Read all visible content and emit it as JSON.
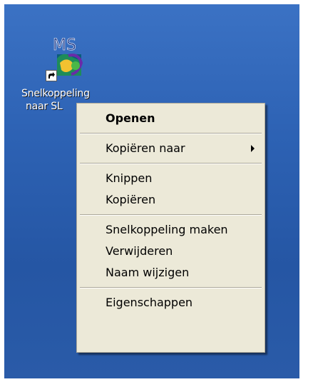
{
  "desktop": {
    "shortcut": {
      "icon": "ms-vs-shortcut-icon",
      "logo_text": "MS",
      "label_line1": "Snelkoppeling",
      "label_line2": "naar SL"
    }
  },
  "context_menu": {
    "items": [
      {
        "label": "Openen",
        "bold": true
      },
      {
        "label": "Kopiëren naar",
        "submenu": true
      },
      {
        "label": "Knippen"
      },
      {
        "label": "Kopiëren"
      },
      {
        "label": "Snelkoppeling maken"
      },
      {
        "label": "Verwijderen"
      },
      {
        "label": "Naam wijzigen"
      },
      {
        "label": "Eigenschappen"
      }
    ]
  },
  "colors": {
    "desktop_blue": "#2d62b4",
    "menu_bg": "#ece9d8",
    "menu_border": "#aca899"
  }
}
